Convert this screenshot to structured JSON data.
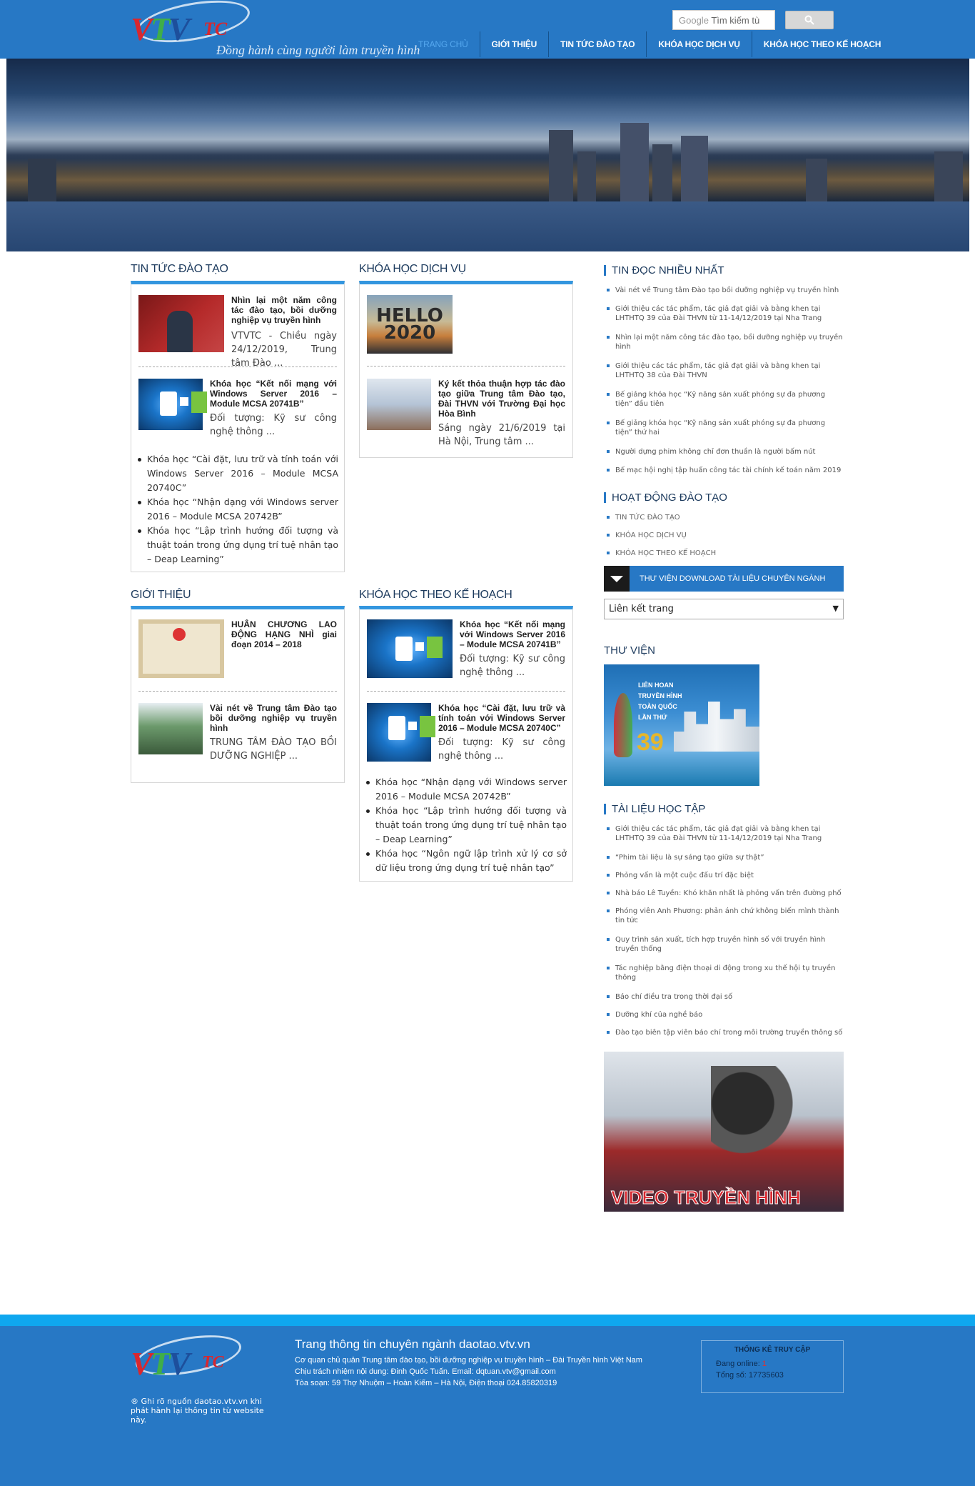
{
  "header": {
    "logo_text": "VTVTC",
    "slogan": "Đồng hành cùng người làm truyền hình",
    "search_placeholder_prefix": "Google",
    "search_placeholder": "Tìm kiếm tù",
    "nav": [
      {
        "label": "Trang chủ",
        "active": true
      },
      {
        "label": "Giới thiệu"
      },
      {
        "label": "Tin tức đào tạo"
      },
      {
        "label": "Khóa học dịch vụ"
      },
      {
        "label": "Khóa học theo kế hoạch"
      }
    ]
  },
  "news": {
    "title": "Tin tức đào tạo",
    "articles": [
      {
        "title": "Nhìn lại một năm công tác đào tạo, bồi dưỡng nghiệp vụ truyền hình",
        "excerpt": "VTVTC - Chiều ngày 24/12/2019, Trung tâm Đào ..."
      },
      {
        "title": "Khóa học “Kết nối mạng với Windows Server 2016 – Module MCSA 20741B”",
        "excerpt": "Đối tượng: Kỹ sư công nghệ thông ..."
      }
    ],
    "links": [
      "Khóa học “Cài đặt, lưu trữ và tính toán với Windows Server 2016 – Module MCSA 20740C”",
      "Khóa học “Nhận dạng với Windows server 2016 – Module MCSA 20742B”",
      "Khóa học “Lập trình hướng đối tượng và thuật toán trong ứng dụng trí tuệ nhân tạo – Deap Learning”"
    ]
  },
  "service": {
    "title": "Khóa học dịch vụ",
    "hello_text": "HELLO 2020",
    "articles": [
      {
        "title": "Ký kết thỏa thuận hợp tác đào tạo giữa Trung tâm Đào tạo, Đài THVN với Trường Đại học Hòa Bình",
        "excerpt": "Sáng ngày 21/6/2019 tại Hà Nội, Trung tâm ..."
      }
    ]
  },
  "intro": {
    "title": "Giới thiệu",
    "articles": [
      {
        "title": "HUÂN CHƯƠNG LAO ĐỘNG HẠNG NHÌ giai đoạn 2014 – 2018",
        "excerpt": ""
      },
      {
        "title": "Vài nét về Trung tâm Đào tạo bồi dưỡng nghiệp vụ truyền hình",
        "excerpt": "TRUNG TÂM ĐÀO TẠO BỒI DƯỠNG NGHIỆP ..."
      }
    ]
  },
  "planned": {
    "title": "Khóa học theo kế hoạch",
    "articles": [
      {
        "title": "Khóa học “Kết nối mạng với Windows Server 2016 – Module MCSA 20741B”",
        "excerpt": "Đối tượng: Kỹ sư công nghệ thông ..."
      },
      {
        "title": "Khóa học “Cài đặt, lưu trữ và tính toán với Windows Server 2016 – Module MCSA 20740C”",
        "excerpt": "Đối tượng: Kỹ sư công nghệ thông ..."
      }
    ],
    "links": [
      "Khóa học “Nhận dạng với Windows server 2016 – Module MCSA 20742B”",
      "Khóa học “Lập trình hướng đối tượng và thuật toán trong ứng dụng trí tuệ nhân tạo – Deap Learning”",
      "Khóa học “Ngôn ngữ lập trình xử lý cơ sở dữ liệu trong ứng dụng trí tuệ nhân tạo”"
    ]
  },
  "sidebar": {
    "popular_title": "Tin đọc nhiều nhất",
    "popular": [
      "Vài nét về Trung tâm Đào tạo bồi dưỡng nghiệp vụ truyền hình",
      "Giới thiệu các tác phẩm, tác giả đạt giải và bằng khen tại LHTHTQ 39 của Đài THVN từ 11-14/12/2019 tại Nha Trang",
      "Nhìn lại một năm công tác đào tạo, bồi dưỡng nghiệp vụ truyền hình",
      "Giới thiệu các tác phẩm, tác giả đạt giải và bằng khen tại LHTHTQ 38 của Đài THVN",
      "Bế giảng khóa học “Kỹ năng sản xuất phóng sự đa phương tiện” đầu tiên",
      "Bế giảng khóa học “Kỹ năng sản xuất phóng sự đa phương tiện” thứ hai",
      "Người dựng phim không chỉ đơn thuần là người bấm nút",
      "Bế mạc hội nghị tập huấn công tác tài chính kế toán năm 2019"
    ],
    "activity_title": "Hoạt động đào tạo",
    "activity": [
      "Tin tức đào tạo",
      "Khóa học dịch vụ",
      "Khóa học theo kế hoạch"
    ],
    "download_label": "Thư viện download tài liệu chuyên ngành",
    "select_value": "Liên kết trang",
    "library_title": "Thư viện",
    "library_img_text": "Liên hoan truyền hình toàn quốc lần thứ",
    "library_img_num": "39",
    "docs_title": "Tài liệu học tập",
    "docs": [
      "Giới thiệu các tác phẩm, tác giả đạt giải và bằng khen tại LHTHTQ 39 của Đài THVN từ 11-14/12/2019 tại Nha Trang",
      "“Phim tài liệu là sự sáng tạo giữa sự thật”",
      "Phỏng vấn là một cuộc đấu trí đặc biệt",
      "Nhà báo Lê Tuyền: Khó khăn nhất là phỏng vấn trên đường phố",
      "Phóng viên Anh Phương: phản ánh chứ không biến mình thành tin tức",
      "Quy trình sản xuất, tích hợp truyền hình số với truyền hình truyền thống",
      "Tác nghiệp bằng điện thoại di động trong xu thế hội tụ truyền thông",
      "Báo chí điều tra trong thời đại số",
      "Dưỡng khí của nghề báo",
      "Đào tạo biên tập viên báo chí trong môi trường truyền thông số"
    ],
    "video_label": "VIDEO TRUYỀN HÌNH"
  },
  "footer": {
    "note": "® Ghi rõ nguồn daotao.vtv.vn khi phát hành lại thông tin từ website này.",
    "site": "Trang thông tin chuyên ngành daotao.vtv.vn",
    "lines": [
      "Cơ quan chủ quản Trung tâm đào tạo, bồi dưỡng nghiệp vụ truyền hình – Đài Truyền hình Việt Nam",
      "Chịu trách nhiệm nội dung: Đinh Quốc Tuấn. Email: dqtuan.vtv@gmail.com",
      "Tòa soạn: 59 Thợ Nhuộm – Hoàn Kiếm – Hà Nội, Điện thoại 024.85820319"
    ],
    "stats_title": "Thống kê truy cập",
    "online_label": "Đang online:",
    "online_value": "1",
    "total_label": "Tổng số:",
    "total_value": "17735603"
  }
}
